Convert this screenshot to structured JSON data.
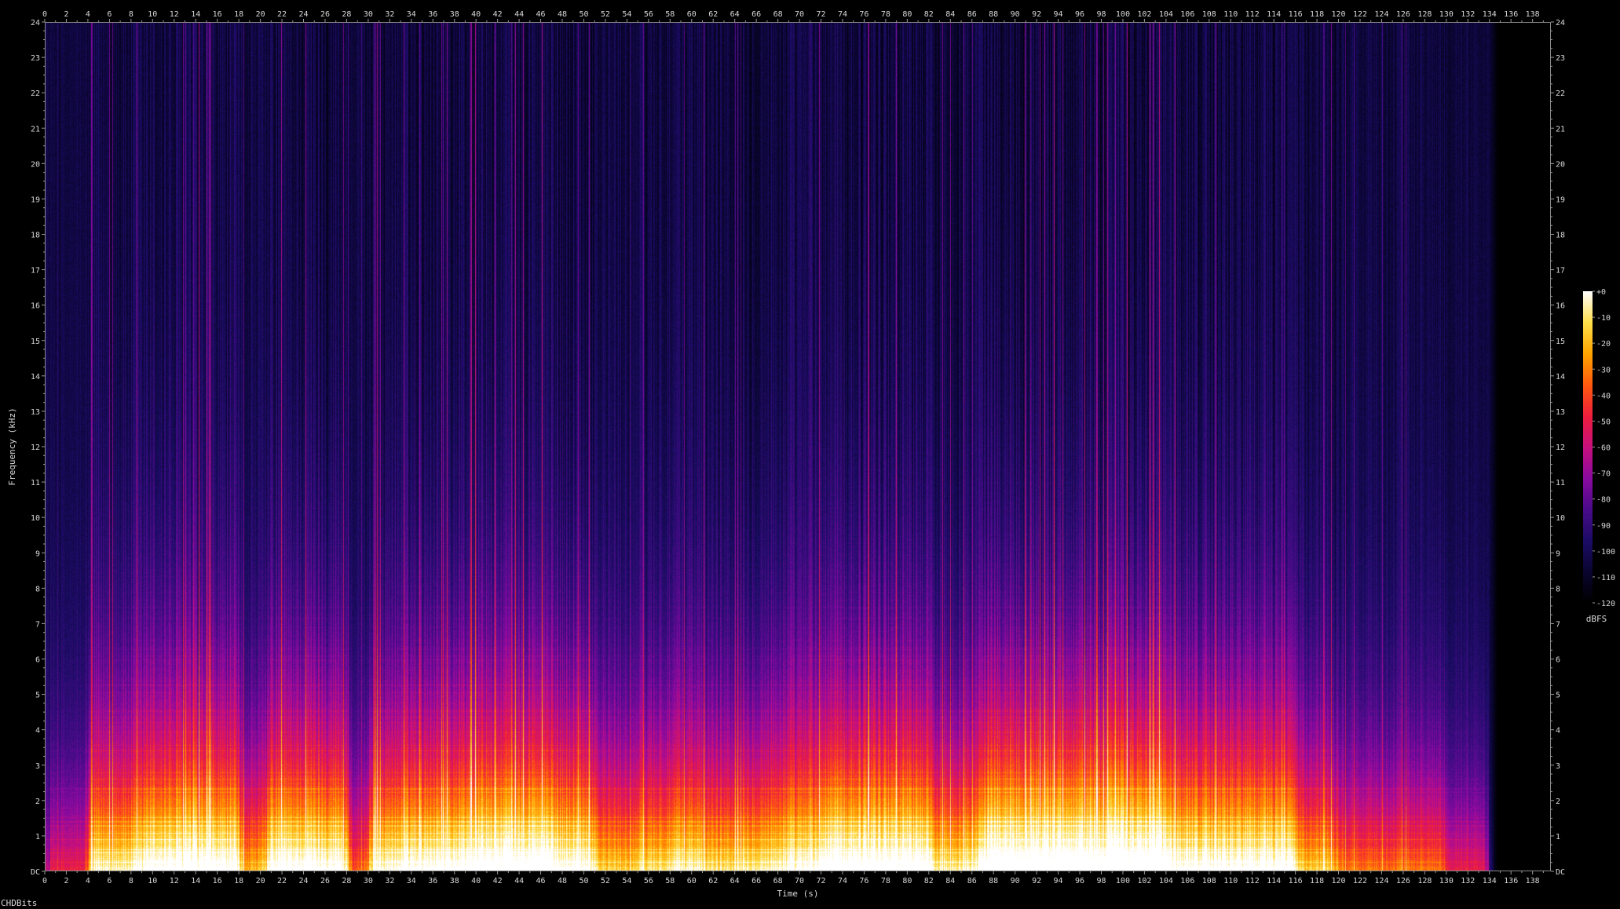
{
  "app": {
    "footer_label": "CHDBits"
  },
  "chart_data": {
    "type": "heatmap",
    "title": "",
    "xlabel": "Time (s)",
    "ylabel": "Frequency (kHz)",
    "xlim": [
      0,
      139.7
    ],
    "ylim": [
      0,
      24
    ],
    "x_ticks": [
      0,
      2,
      4,
      6,
      8,
      10,
      12,
      14,
      16,
      18,
      20,
      22,
      24,
      26,
      28,
      30,
      32,
      34,
      36,
      38,
      40,
      42,
      44,
      46,
      48,
      50,
      52,
      54,
      56,
      58,
      60,
      62,
      64,
      66,
      68,
      70,
      72,
      74,
      76,
      78,
      80,
      82,
      84,
      86,
      88,
      90,
      92,
      94,
      96,
      98,
      100,
      102,
      104,
      106,
      108,
      110,
      112,
      114,
      116,
      118,
      120,
      122,
      124,
      126,
      128,
      130,
      132,
      134,
      136,
      138
    ],
    "y_ticks": [
      "DC",
      "1",
      "2",
      "3",
      "4",
      "5",
      "6",
      "7",
      "8",
      "9",
      "10",
      "11",
      "12",
      "13",
      "14",
      "15",
      "16",
      "17",
      "18",
      "19",
      "20",
      "21",
      "22",
      "23",
      "24"
    ],
    "audio_end_s": 134,
    "colorbar": {
      "label": "dBFS",
      "ticks": [
        "+0",
        "-10",
        "-20",
        "-30",
        "-40",
        "-50",
        "-60",
        "-70",
        "-80",
        "-90",
        "-100",
        "-110",
        "-120"
      ],
      "range": [
        -120,
        0
      ],
      "colors": [
        "#000000",
        "#0a0530",
        "#1c0c66",
        "#4a0b8a",
        "#8a0aa0",
        "#c8107e",
        "#ee1f3c",
        "#ff5a10",
        "#ffa400",
        "#ffe04a",
        "#ffffff"
      ]
    },
    "energy_segments": [
      {
        "start": 0,
        "end": 4,
        "level": 0.45
      },
      {
        "start": 4,
        "end": 9,
        "level": 0.85
      },
      {
        "start": 9,
        "end": 18,
        "level": 0.95
      },
      {
        "start": 18,
        "end": 20.5,
        "level": 0.7
      },
      {
        "start": 20.5,
        "end": 28,
        "level": 0.95
      },
      {
        "start": 28,
        "end": 30,
        "level": 0.55
      },
      {
        "start": 30,
        "end": 33.5,
        "level": 0.9
      },
      {
        "start": 33.5,
        "end": 39,
        "level": 0.95
      },
      {
        "start": 39,
        "end": 47,
        "level": 1.0
      },
      {
        "start": 47,
        "end": 51,
        "level": 0.95
      },
      {
        "start": 51,
        "end": 55,
        "level": 0.75
      },
      {
        "start": 55,
        "end": 58,
        "level": 0.8
      },
      {
        "start": 58,
        "end": 61,
        "level": 0.85
      },
      {
        "start": 61,
        "end": 64,
        "level": 0.8
      },
      {
        "start": 64,
        "end": 68,
        "level": 0.85
      },
      {
        "start": 68,
        "end": 72,
        "level": 0.9
      },
      {
        "start": 72,
        "end": 82,
        "level": 1.0
      },
      {
        "start": 82,
        "end": 87,
        "level": 0.85
      },
      {
        "start": 87,
        "end": 104,
        "level": 1.05
      },
      {
        "start": 104,
        "end": 116,
        "level": 0.95
      },
      {
        "start": 116,
        "end": 120,
        "level": 0.75
      },
      {
        "start": 120,
        "end": 130,
        "level": 0.6
      },
      {
        "start": 130,
        "end": 134,
        "level": 0.45
      }
    ]
  }
}
